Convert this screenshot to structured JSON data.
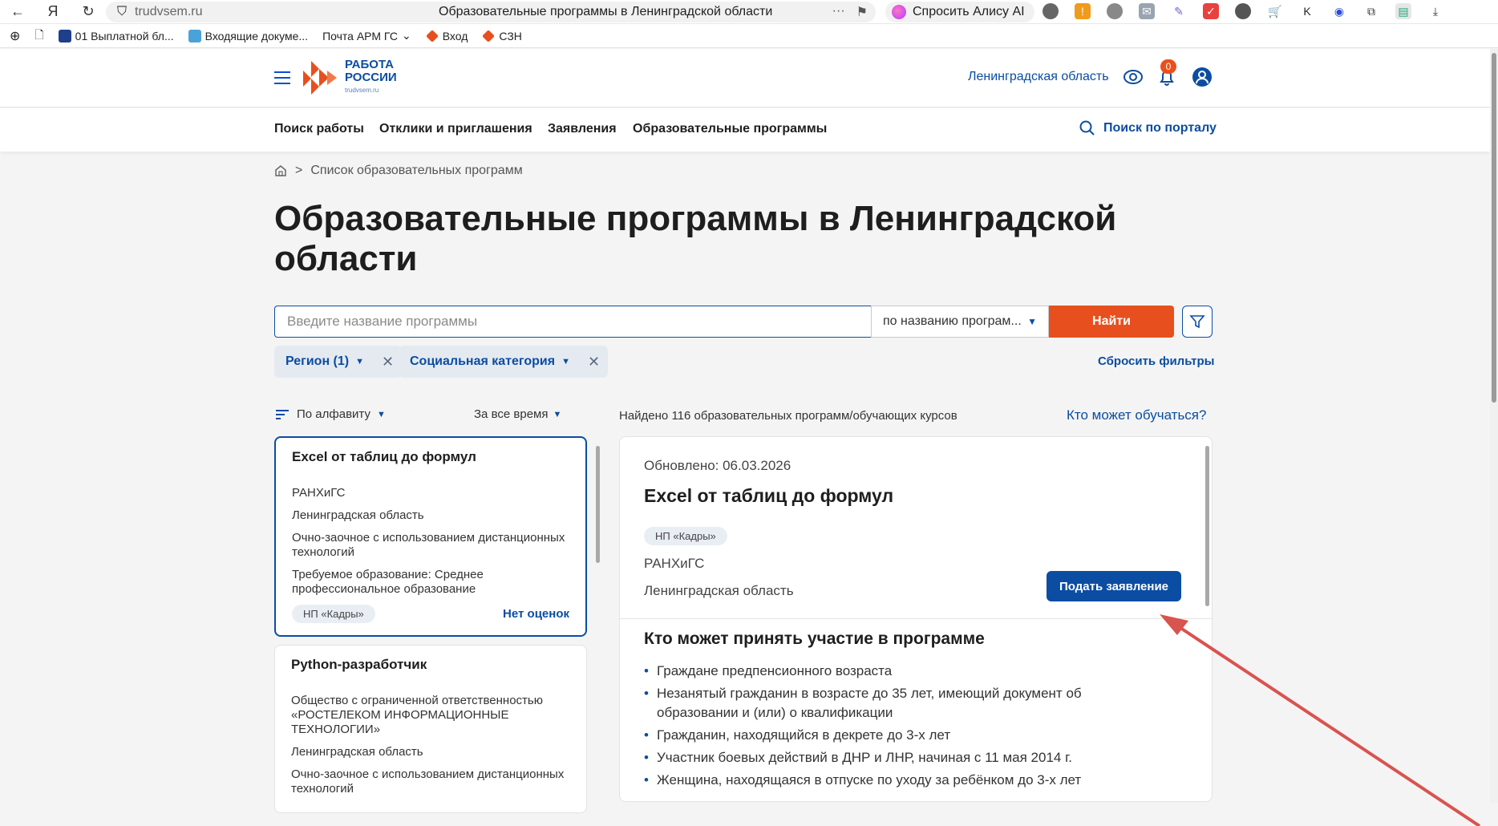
{
  "browser": {
    "url": "trudvsem.ru",
    "tab_title": "Образовательные программы в Ленинградской области",
    "alice_label": "Спросить Алису AI"
  },
  "bookmarks": [
    {
      "label": "01 Выплатной бл..."
    },
    {
      "label": "Входящие докуме..."
    },
    {
      "label": "Почта АРМ ГС"
    },
    {
      "label": "Вход"
    },
    {
      "label": "СЗН"
    }
  ],
  "header": {
    "logo_line1": "РАБОТА",
    "logo_line2": "РОССИИ",
    "logo_sub": "trudvsem.ru",
    "region": "Ленинградская область",
    "notifications_count": "0"
  },
  "nav": {
    "items": [
      "Поиск работы",
      "Отклики и приглашения",
      "Заявления",
      "Образовательные программы"
    ],
    "portal_search": "Поиск по порталу"
  },
  "breadcrumb": {
    "current": "Список образовательных программ",
    "separator": ">"
  },
  "page_title": "Образовательные программы в Ленинградской области",
  "search": {
    "placeholder": "Введите название программы",
    "mode": "по названию програм...",
    "button": "Найти"
  },
  "filters": {
    "region": "Регион (1)",
    "social": "Социальная категория",
    "reset": "Сбросить фильтры"
  },
  "list_controls": {
    "sort": "По алфавиту",
    "period": "За все время",
    "found": "Найдено 116 образовательных программ/обучающих курсов",
    "who_can": "Кто может обучаться?"
  },
  "cards": [
    {
      "title": "Excel от таблиц до формул",
      "org": "РАНХиГС",
      "region": "Ленинградская область",
      "form": "Очно-заочное с использованием дистанционных технологий",
      "education": "Требуемое образование: Среднее профессиональное образование",
      "tag": "НП «Кадры»",
      "rating": "Нет оценок"
    },
    {
      "title": "Python-разработчик",
      "org": "Общество с ограниченной ответственностью «РОСТЕЛЕКОМ ИНФОРМАЦИОННЫЕ ТЕХНОЛОГИИ»",
      "region": "Ленинградская область",
      "form": "Очно-заочное с использованием дистанционных технологий"
    }
  ],
  "detail": {
    "updated": "Обновлено: 06.03.2026",
    "title": "Excel от таблиц до формул",
    "tag": "НП «Кадры»",
    "org": "РАНХиГС",
    "region": "Ленинградская область",
    "apply": "Подать заявление",
    "section_title": "Кто может принять участие в программе",
    "participants": [
      "Граждане предпенсионного возраста",
      "Незанятый гражданин в возрасте до 35 лет, имеющий документ об образовании и (или) о квалификации",
      "Гражданин, находящийся в декрете до 3-х лет",
      "Участник боевых действий в ДНР и ЛНР, начиная с 11 мая 2014 г.",
      "Женщина, находящаяся в отпуске по уходу за ребёнком до 3-х лет"
    ]
  },
  "colors": {
    "brand_blue": "#0b4da2",
    "accent_orange": "#e7501e",
    "annotation_arrow": "#d9534f"
  }
}
